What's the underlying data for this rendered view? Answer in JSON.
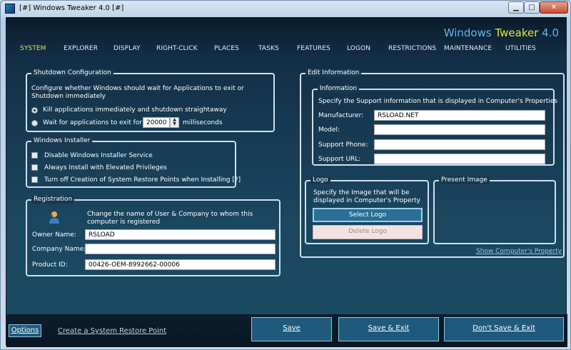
{
  "window": {
    "title": "[#] Windows Tweaker 4.0 [#]",
    "min_glyph": "▁",
    "max_glyph": "□",
    "close_glyph": "✕"
  },
  "brand": {
    "part1": "Windows ",
    "part2": "Tweaker",
    "part3": " 4.0"
  },
  "nav": [
    {
      "label": "SYSTEM",
      "active": true
    },
    {
      "label": "EXPLORER"
    },
    {
      "label": "DISPLAY"
    },
    {
      "label": "RIGHT-CLICK"
    },
    {
      "label": "PLACES"
    },
    {
      "label": "TASKS"
    },
    {
      "label": "FEATURES"
    },
    {
      "label": "LOGON"
    },
    {
      "label": "RESTRICTIONS"
    },
    {
      "label": "MAINTENANCE"
    },
    {
      "label": "UTILITIES"
    }
  ],
  "shutdown": {
    "title": "Shutdown Configuration",
    "description": "Configure whether Windows should wait for Applications to exit or Shutdown immediately",
    "option_kill": "Kill applications immediately and shutdown straightaway",
    "option_wait": "Wait for applications to exit for",
    "wait_value": "20000",
    "wait_unit": "milliseconds",
    "selected": "kill"
  },
  "installer": {
    "title": "Windows Installer",
    "items": [
      "Disable Windows Installer Service",
      "Always Install with Elevated Privileges",
      "Turn off Creation of System Restore Points when Installing [?]"
    ]
  },
  "registration": {
    "title": "Registration",
    "description": "Change the name of User & Company to whom this computer is registered",
    "owner_label": "Owner Name:",
    "owner_value": "RSLOAD",
    "company_label": "Company Name:",
    "company_value": "",
    "product_label": "Product ID:",
    "product_value": "00426-OEM-8992662-00006"
  },
  "edit_info": {
    "title": "Edit Information",
    "info_title": "Information",
    "info_desc": "Specify the Support information that is displayed in Computer's Properties",
    "manufacturer_label": "Manufacturer:",
    "manufacturer_value": "RSLOAD.NET",
    "model_label": "Model:",
    "model_value": "",
    "phone_label": "Support Phone:",
    "phone_value": "",
    "url_label": "Support URL:",
    "url_value": "",
    "logo_title": "Logo",
    "logo_desc": "Specify the Image that will be displayed in Computer's Property",
    "select_logo": "Select Logo",
    "delete_logo": "Delete Logo",
    "present_title": "Present Image",
    "show_props": "Show Computer's Property"
  },
  "footer": {
    "options": "Options",
    "restore_point": "Create a System Restore Point",
    "save": "Save",
    "save_exit": "Save & Exit",
    "dont_save": "Don't Save & Exit"
  }
}
